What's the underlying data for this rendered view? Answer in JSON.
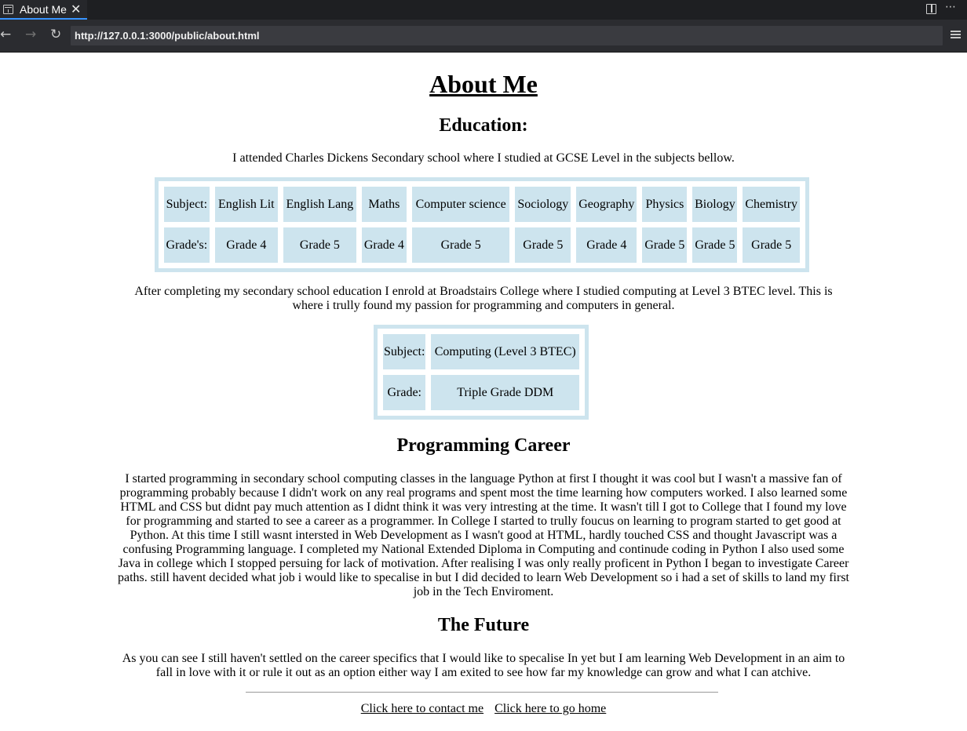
{
  "browser": {
    "tab_title": "About Me",
    "url": "http://127.0.0.1:3000/public/about.html",
    "icons": [
      "page-icon",
      "close-icon",
      "split-editor-icon",
      "more-icon",
      "back-icon",
      "forward-icon",
      "reload-icon",
      "menu-icon"
    ]
  },
  "page": {
    "title": "About Me",
    "education": {
      "heading": "Education:",
      "intro": "I attended Charles Dickens Secondary school where I studied at GCSE Level in the subjects bellow.",
      "gcse_table": {
        "row_labels": [
          "Subject:",
          "Grade's:"
        ],
        "subjects": [
          "English Lit",
          "English Lang",
          "Maths",
          "Computer science",
          "Sociology",
          "Geography",
          "Physics",
          "Biology",
          "Chemistry"
        ],
        "grades": [
          "Grade 4",
          "Grade 5",
          "Grade 4",
          "Grade 5",
          "Grade 5",
          "Grade 4",
          "Grade 5",
          "Grade 5",
          "Grade 5"
        ]
      },
      "college_text": "After completing my secondary school education I enrold at Broadstairs College where I studied computing at Level 3 BTEC level. This is where i trully found my passion for programming and computers in general.",
      "college_table": {
        "subject_label": "Subject:",
        "subject": "Computing (Level 3 BTEC)",
        "grade_label": "Grade:",
        "grade": "Triple Grade DDM"
      }
    },
    "career": {
      "heading": "Programming Career",
      "text": "I started programming in secondary school computing classes in the language Python at first I thought it was cool but I wasn't a massive fan of programming probably because I didn't work on any real programs and spent most the time learning how computers worked. I also learned some HTML and CSS but didnt pay much attention as I didnt think it was very intresting at the time. It wasn't till I got to College that I found my love for programming and started to see a career as a programmer. In College I started to trully foucus on learning to program started to get good at Python. At this time I still wasnt intersted in Web Development as I wasn't good at HTML, hardly touched CSS and thought Javascript was a confusing Programming language. I completed my National Extended Diploma in Computing and continude coding in Python I also used some Java in college which I stopped persuing for lack of motivation. After realising I was only really proficent in Python I began to investigate Career paths. still havent decided what job i would like to specalise in but I did decided to learn Web Development so i had a set of skills to land my first job in the Tech Enviroment."
    },
    "future": {
      "heading": "The Future",
      "text": "As you can see I still haven't settled on the career specifics that I would like to specalise In yet but I am learning Web Development in an aim to fall in love with it or rule it out as an option either way I am exited to see how far my knowledge can grow and what I can atchive."
    },
    "footer": {
      "contact_link": "Click here to contact me",
      "home_link": "Click here to go home"
    }
  }
}
